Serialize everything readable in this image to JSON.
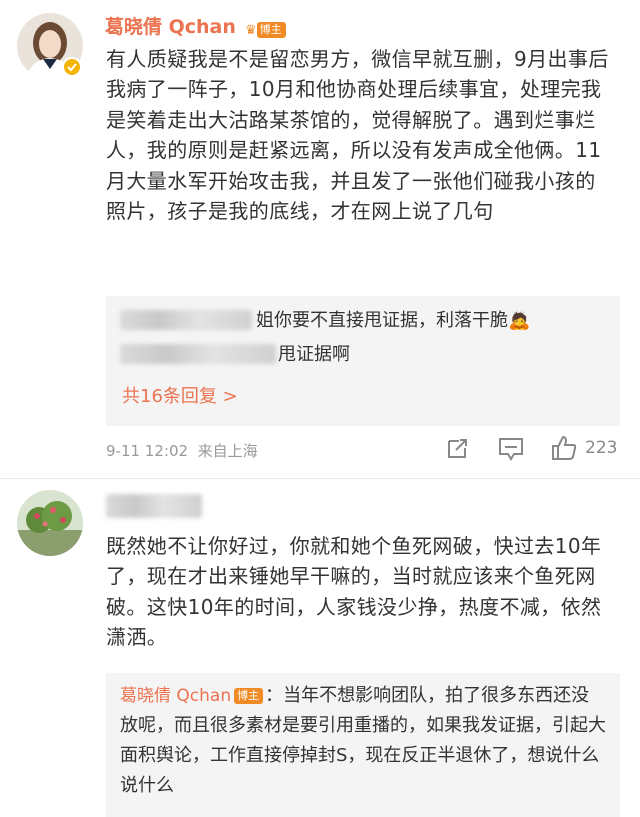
{
  "comment1": {
    "user": {
      "name": "葛晓倩 Qchan",
      "badge": "博主"
    },
    "text": "有人质疑我是不是留恋男方，微信早就互删，9月出事后我病了一阵子，10月和他协商处理后续事宜，处理完我是笑着走出大沽路某茶馆的，觉得解脱了。遇到烂事烂人，我的原则是赶紧远离，所以没有发声成全他俩。11月大量水军开始攻击我，并且发了一张他们碰我小孩的照片，孩子是我的底线，才在网上说了几句",
    "replies": [
      {
        "text": "姐你要不直接甩证据，利落干脆",
        "emoji": "🙇"
      },
      {
        "text": "甩证据啊"
      }
    ],
    "more_replies": "共16条回复 >",
    "time": "9-11 12:02",
    "source": "来自上海",
    "likes": "223"
  },
  "comment2": {
    "text": "既然她不让你好过，你就和她个鱼死网破，快过去10年了，现在才出来锤她早干嘛的，当时就应该来个鱼死网破。这快10年的时间，人家钱没少挣，热度不减，依然潇洒。",
    "reply": {
      "name": "葛晓倩 Qchan",
      "badge": "博主",
      "text": "：当年不想影响团队，拍了很多东西还没放呢，而且很多素材是要引用重播的，如果我发证据，引起大面积舆论，工作直接停掉封S，现在反正半退休了，想说什么说什么"
    }
  },
  "colors": {
    "accent": "#eb7350",
    "badge": "#f08a24",
    "reply_bg": "#f4f4f4",
    "verified": "#f5b400"
  }
}
